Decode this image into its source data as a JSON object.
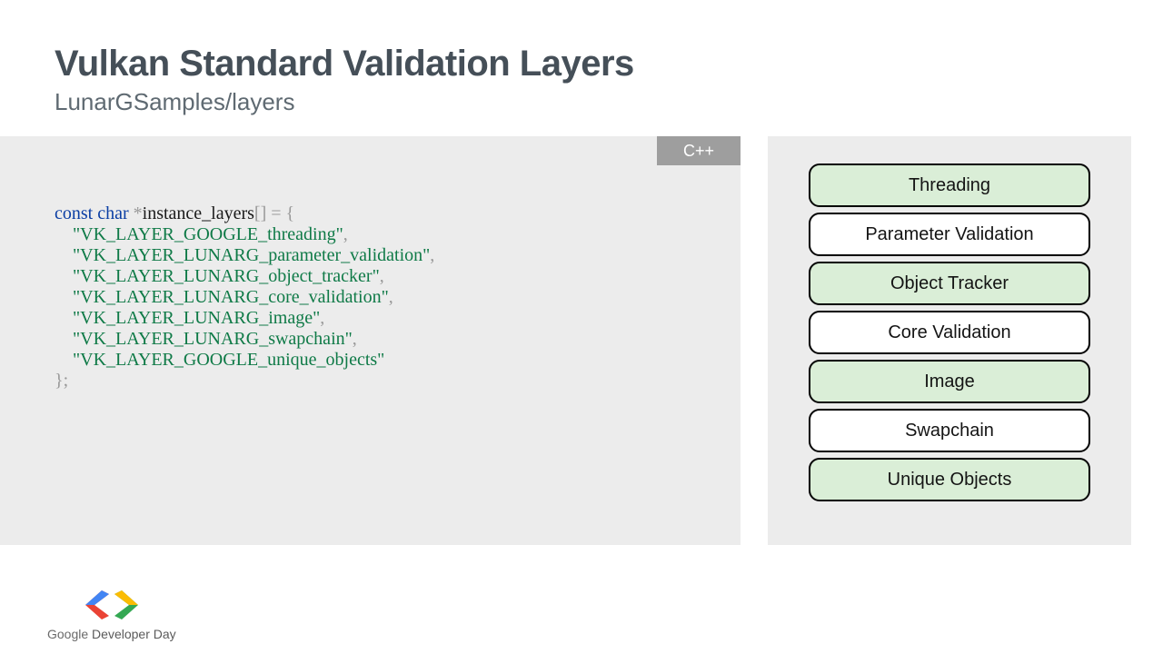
{
  "header": {
    "title": "Vulkan Standard Validation Layers",
    "subtitle": "LunarGSamples/layers"
  },
  "code": {
    "language": "C++",
    "decl_kw": "const char",
    "decl_ptr": "*",
    "decl_name": "instance_layers",
    "decl_suffix": "[] = {",
    "strings": [
      "\"VK_LAYER_GOOGLE_threading\"",
      "\"VK_LAYER_LUNARG_parameter_validation\"",
      "\"VK_LAYER_LUNARG_object_tracker\"",
      "\"VK_LAYER_LUNARG_core_validation\"",
      "\"VK_LAYER_LUNARG_image\"",
      "\"VK_LAYER_LUNARG_swapchain\"",
      "\"VK_LAYER_GOOGLE_unique_objects\""
    ],
    "close": "};"
  },
  "layers": [
    {
      "label": "Threading",
      "shade": "g"
    },
    {
      "label": "Parameter Validation",
      "shade": "w"
    },
    {
      "label": "Object Tracker",
      "shade": "g"
    },
    {
      "label": "Core Validation",
      "shade": "w"
    },
    {
      "label": "Image",
      "shade": "g"
    },
    {
      "label": "Swapchain",
      "shade": "w"
    },
    {
      "label": "Unique Objects",
      "shade": "g"
    }
  ],
  "footer": {
    "brand": "Google",
    "event": " Developer Day"
  }
}
